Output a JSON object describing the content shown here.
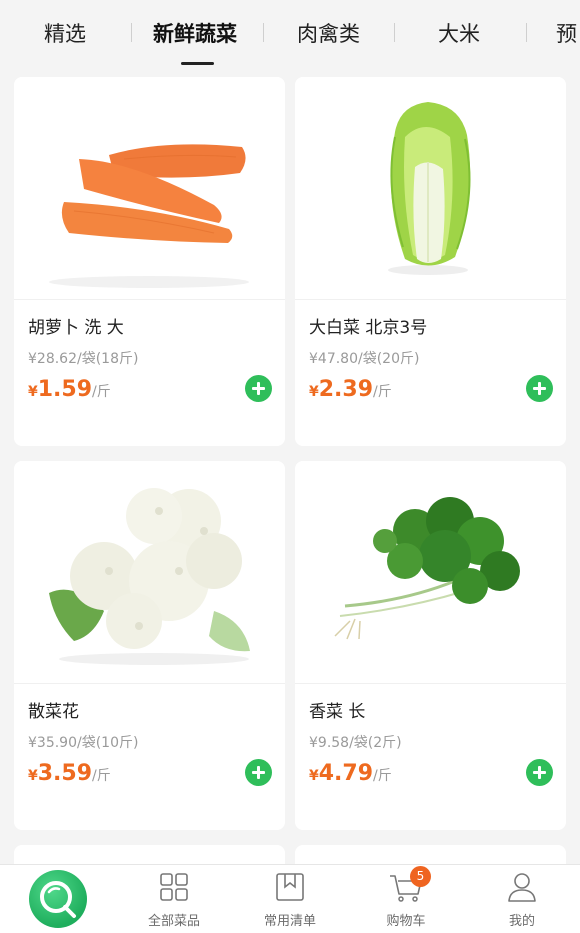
{
  "tabs": [
    "精选",
    "新鲜蔬菜",
    "肉禽类",
    "大米",
    "预"
  ],
  "active_tab": "新鲜蔬菜",
  "products": [
    {
      "name": "胡萝卜 洗 大",
      "spec": "¥28.62/袋(18斤)",
      "currency": "¥",
      "price": "1.59",
      "unit": "/斤",
      "image": "carrot"
    },
    {
      "name": "大白菜 北京3号",
      "spec": "¥47.80/袋(20斤)",
      "currency": "¥",
      "price": "2.39",
      "unit": "/斤",
      "image": "napa-cabbage"
    },
    {
      "name": "散菜花",
      "spec": "¥35.90/袋(10斤)",
      "currency": "¥",
      "price": "3.59",
      "unit": "/斤",
      "image": "cauliflower"
    },
    {
      "name": "香菜 长",
      "spec": "¥9.58/袋(2斤)",
      "currency": "¥",
      "price": "4.79",
      "unit": "/斤",
      "image": "coriander"
    }
  ],
  "bottom_nav": {
    "items": [
      {
        "label": "",
        "icon": "home-logo-icon"
      },
      {
        "label": "全部菜品",
        "icon": "grid-icon"
      },
      {
        "label": "常用清单",
        "icon": "bookmark-list-icon"
      },
      {
        "label": "购物车",
        "icon": "cart-icon"
      },
      {
        "label": "我的",
        "icon": "user-icon"
      }
    ],
    "cart_badge": "5"
  },
  "colors": {
    "price": "#ee6a1f",
    "add_button": "#2fbe5a",
    "badge": "#ef6420"
  }
}
